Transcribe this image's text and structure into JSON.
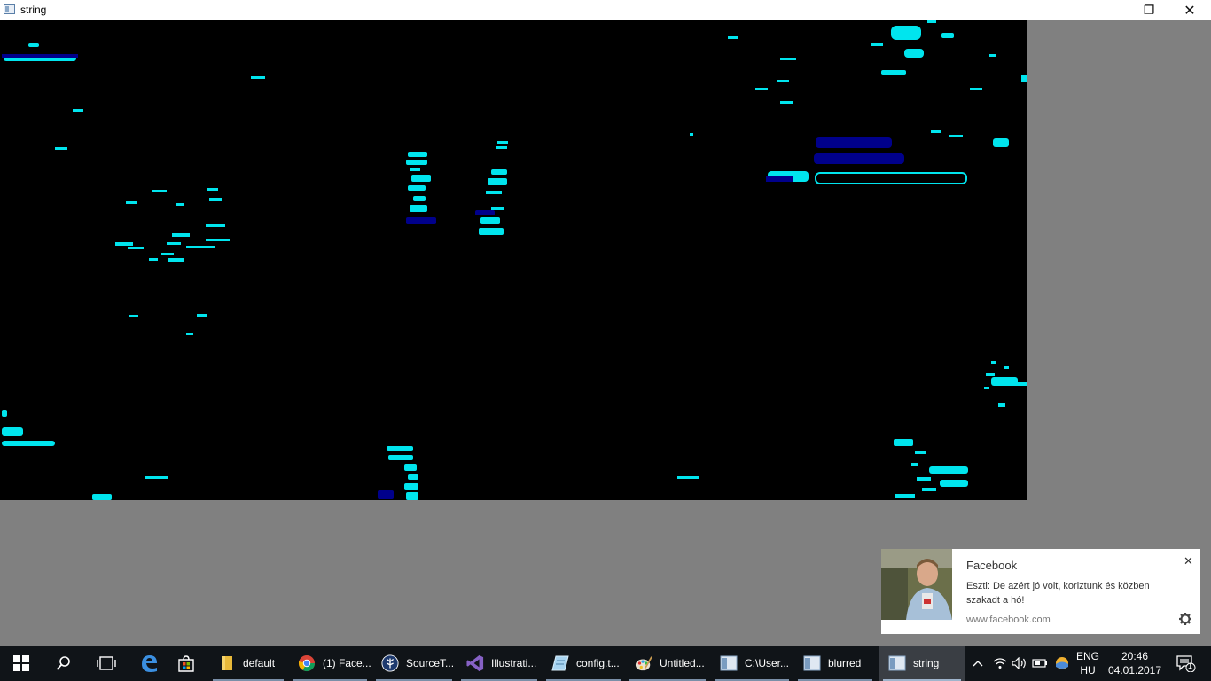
{
  "window": {
    "title": "string",
    "minimize_glyph": "—",
    "maximize_glyph": "❐",
    "close_glyph": "✕"
  },
  "toast": {
    "app": "Facebook",
    "message": "Eszti: De azért jó volt, koriztunk és közben szakadt a hó!",
    "source": "www.facebook.com",
    "close_glyph": "✕",
    "settings_icon": "gear-icon"
  },
  "taskbar": {
    "apps": [
      {
        "label": "default",
        "icon": "folder-icon"
      },
      {
        "label": "(1) Face...",
        "icon": "chrome-icon"
      },
      {
        "label": "SourceT...",
        "icon": "sourcetree-icon"
      },
      {
        "label": "Illustrati...",
        "icon": "visual-studio-icon"
      },
      {
        "label": "config.t...",
        "icon": "notepad-icon"
      },
      {
        "label": "Untitled...",
        "icon": "paint-icon"
      },
      {
        "label": "C:\\User...",
        "icon": "window-icon"
      },
      {
        "label": "blurred",
        "icon": "window-icon"
      },
      {
        "label": "string",
        "icon": "window-icon"
      }
    ],
    "language_top": "ENG",
    "language_bottom": "HU",
    "time": "20:46",
    "date": "04.01.2017",
    "notification_count": "1"
  },
  "colors": {
    "cyan": "#00e5ee",
    "navy": "#00008b",
    "taskbar": "#101418",
    "background": "#808080"
  }
}
